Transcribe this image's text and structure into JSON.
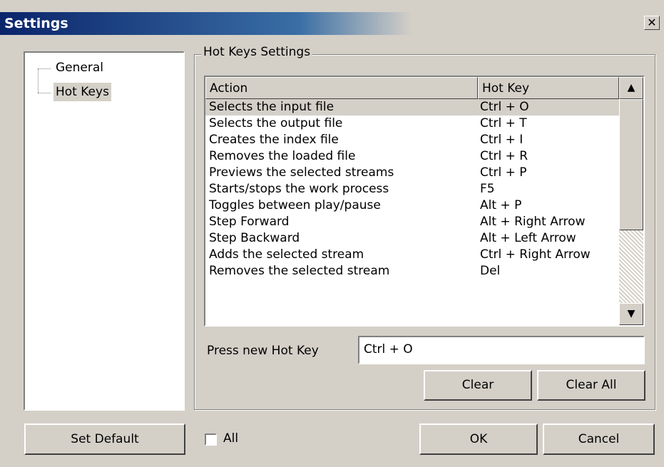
{
  "window": {
    "title": "Settings",
    "close_glyph": "✕"
  },
  "tree": {
    "items": [
      {
        "label": "General",
        "selected": false
      },
      {
        "label": "Hot Keys",
        "selected": true
      }
    ]
  },
  "hotkeys": {
    "group_title": "Hot Keys Settings",
    "columns": [
      "Action",
      "Hot Key"
    ],
    "rows": [
      [
        "Selects the input file",
        "Ctrl + O"
      ],
      [
        "Selects the output file",
        "Ctrl + T"
      ],
      [
        "Creates the index file",
        "Ctrl + I"
      ],
      [
        "Removes the loaded file",
        "Ctrl + R"
      ],
      [
        "Previews the selected streams",
        "Ctrl + P"
      ],
      [
        "Starts/stops the work process",
        "F5"
      ],
      [
        "Toggles between play/pause",
        "Alt + P"
      ],
      [
        "Step Forward",
        "Alt + Right Arrow"
      ],
      [
        "Step Backward",
        "Alt + Left Arrow"
      ],
      [
        "Adds the selected stream",
        "Ctrl + Right Arrow"
      ],
      [
        "Removes the selected stream",
        "Del"
      ]
    ],
    "selected_row": 0,
    "new_key_label": "Press new Hot Key",
    "new_key_value": "Ctrl + O",
    "clear_label": "Clear",
    "clear_all_label": "Clear All",
    "scroll_up_icon": "arrow-up-icon",
    "scroll_down_icon": "arrow-down-icon"
  },
  "footer": {
    "set_default_label": "Set Default",
    "all_checkbox_label": "All",
    "all_checked": false,
    "ok_label": "OK",
    "cancel_label": "Cancel"
  }
}
